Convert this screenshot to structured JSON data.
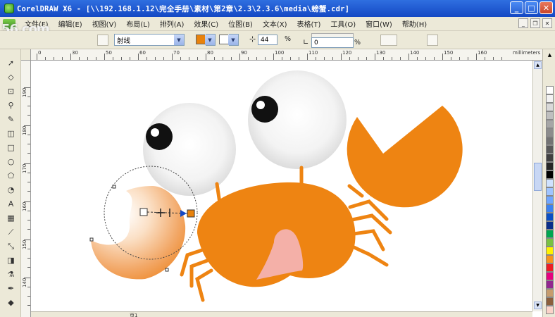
{
  "window": {
    "title": "CorelDRAW X6 - [\\\\192.168.1.12\\完全手册\\素材\\第2章\\2.3\\2.3.6\\media\\螃蟹.cdr]",
    "controls": {
      "minimize": "_",
      "maximize": "□",
      "close": "✕"
    }
  },
  "watermark": {
    "main": "56",
    "suffix": ".com"
  },
  "menu": {
    "items": [
      "文件(F)",
      "编辑(E)",
      "视图(V)",
      "布局(L)",
      "排列(A)",
      "效果(C)",
      "位图(B)",
      "文本(X)",
      "表格(T)",
      "工具(O)",
      "窗口(W)",
      "帮助(H)"
    ]
  },
  "propbar": {
    "fill_type": "射线",
    "midpoint_value": "44",
    "percent_sign": "%",
    "angle_value": "0",
    "fill_color": "#e8820c",
    "second_color": "#ffffff"
  },
  "ruler": {
    "top_labels": [
      "0",
      "30",
      "50",
      "60",
      "70",
      "80",
      "90",
      "100",
      "110",
      "120",
      "130",
      "140",
      "150",
      "160"
    ],
    "unit": "millimeters",
    "left_labels": [
      "190",
      "180",
      "170",
      "160",
      "150",
      "140"
    ]
  },
  "palette": {
    "colors": [
      "#ffffff",
      "#f2f2f2",
      "#d9d9d9",
      "#bfbfbf",
      "#a6a6a6",
      "#8c8c8c",
      "#737373",
      "#595959",
      "#404040",
      "#262626",
      "#000000",
      "#cfe2ff",
      "#9fc4ff",
      "#6fa6ff",
      "#3c82f0",
      "#0a4fc4",
      "#0a2e8a",
      "#00a650",
      "#7ac143",
      "#fff200",
      "#f7941d",
      "#ed1c24",
      "#e6007e",
      "#92278f",
      "#c69c6d",
      "#8b5e3c",
      "#fbd3c9"
    ]
  },
  "canvas": {
    "crab_color": "#ee8412",
    "mouth_color": "#f4b0a8",
    "pupil_color": "#111111"
  },
  "bottombar": {
    "page": "页1"
  }
}
